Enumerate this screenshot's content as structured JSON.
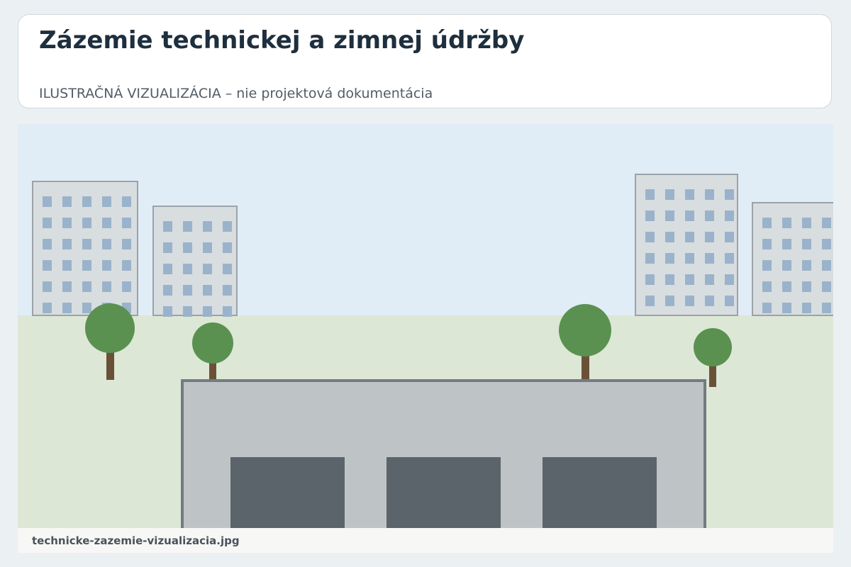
{
  "header": {
    "title": "Zázemie technickej a zimnej údržby",
    "subtitle": "ILUSTRAČNÁ VIZUALIZÁCIA – nie projektová dokumentácia"
  },
  "illustration": {
    "description_icons": [
      "apartment-building-icon",
      "tree-icon",
      "garage-building-icon",
      "garage-door-icon"
    ]
  },
  "caption": {
    "filename": "technicke-zazemie-vizualizacia.jpg"
  },
  "colors": {
    "background": "#ebf0f3",
    "title": "#1e2f3e",
    "sky": "#e1edf6",
    "grass": "#dde7d6",
    "building_fill": "#d8dde0",
    "building_stroke": "#9aa2a8",
    "window": "#9ab3cb",
    "tree_crown": "#5a9150",
    "tree_trunk": "#6b5038",
    "garage_body": "#bec3c6",
    "garage_stroke": "#737b81",
    "garage_door": "#5c646b",
    "caption_bg": "#f7f7f6"
  }
}
